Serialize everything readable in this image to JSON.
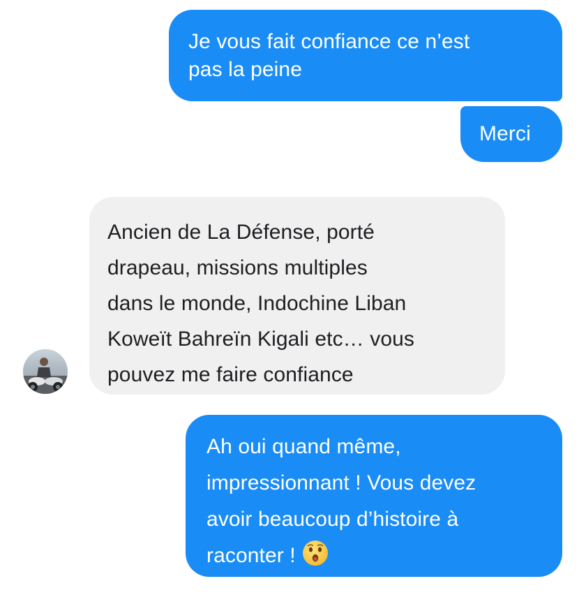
{
  "conversation": {
    "messages": [
      {
        "sender": "me",
        "lines": [
          "Je vous fait confiance ce n’est",
          "pas la peine"
        ]
      },
      {
        "sender": "me",
        "lines": [
          "Merci"
        ]
      },
      {
        "sender": "contact",
        "lines": [
          "Ancien de La Défense, porté",
          "drapeau, missions multiples",
          "dans le monde, Indochine Liban",
          "Koweït Bahreïn Kigali etc…  vous",
          "pouvez me faire confiance"
        ]
      },
      {
        "sender": "me",
        "lines": [
          "Ah oui quand même,",
          "impressionnant ! Vous devez",
          "avoir beaucoup d’histoire à",
          "raconter !"
        ],
        "trailing_emoji": "hushed-face-emoji"
      }
    ],
    "contact_avatar": {
      "icon": "contact-avatar-photo"
    }
  },
  "colors": {
    "sent_bubble": "#1a8cf6",
    "sent_text": "#ffffff",
    "received_bubble": "#f1f0f0",
    "received_text": "#1c1e21",
    "background": "#ffffff"
  }
}
